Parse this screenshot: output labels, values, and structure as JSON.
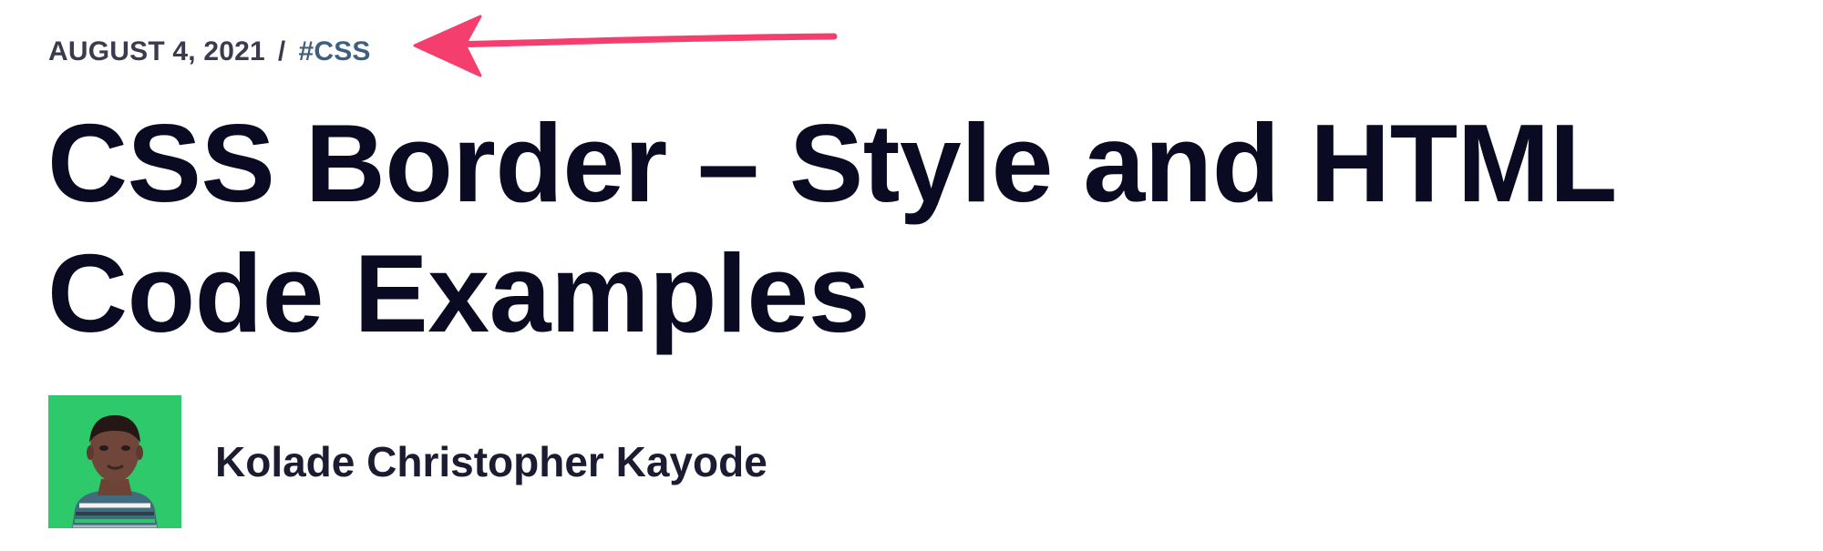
{
  "post_meta": {
    "date": "AUGUST 4, 2021",
    "separator": "/",
    "tag": "#CSS"
  },
  "post": {
    "title": "CSS Border – Style and HTML Code Examples"
  },
  "author": {
    "name": "Kolade Christopher Kayode",
    "avatar_icon": "author-avatar-photo"
  },
  "annotation": {
    "arrow_icon": "pink-arrow-icon",
    "arrow_color": "#f43f6e"
  },
  "colors": {
    "title": "#0a0a23",
    "meta": "#3b3b4f",
    "tag": "#3f5f7f",
    "avatar_background": "#2ec96a"
  }
}
